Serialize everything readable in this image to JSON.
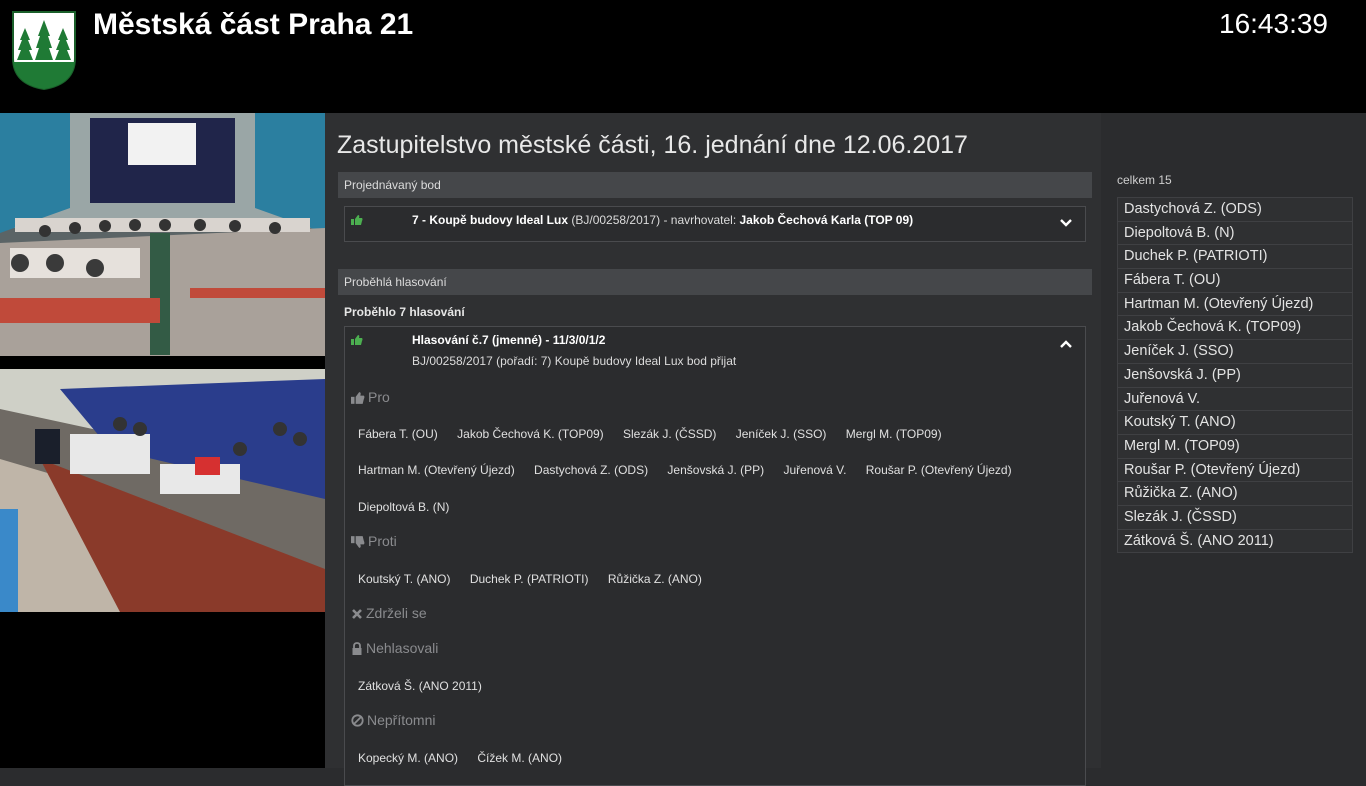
{
  "header": {
    "title": "Městská část Praha 21",
    "clock": "16:43:39"
  },
  "meeting": {
    "title": "Zastupitelstvo městské části, 16. jednání dne 12.06.2017"
  },
  "current_item": {
    "section_label": "Projednávaný bod",
    "number": "7 - Koupě budovy Ideal Lux",
    "code": "(BJ/00258/2017)",
    "proposer_label": "- navrhovatel:",
    "proposer": "Jakob Čechová Karla (TOP 09)"
  },
  "past_votes": {
    "section_label": "Proběhlá hlasování",
    "count_label": "Proběhlo 7 hlasování",
    "vote": {
      "title": "Hlasování č.7 (jmenné) - 11/3/0/1/2",
      "subtitle": "BJ/00258/2017 (pořadí: 7) Koupě budovy Ideal Lux bod přijat",
      "categories": {
        "for": {
          "label": "Pro",
          "rows": [
            [
              "Fábera T. (OU)",
              "Jakob Čechová K. (TOP09)",
              "Slezák J. (ČSSD)",
              "Jeníček J. (SSO)",
              "Mergl M. (TOP09)"
            ],
            [
              "Hartman M. (Otevřený Újezd)",
              "Dastychová Z. (ODS)",
              "Jenšovská J. (PP)",
              "Juřenová V.",
              "Roušar P. (Otevřený Újezd)"
            ],
            [
              "Diepoltová B. (N)"
            ]
          ]
        },
        "against": {
          "label": "Proti",
          "rows": [
            [
              "Koutský T. (ANO)",
              "Duchek P. (PATRIOTI)",
              "Růžička Z. (ANO)"
            ]
          ]
        },
        "abstained": {
          "label": "Zdrželi se"
        },
        "not_voted": {
          "label": "Nehlasovali",
          "rows": [
            [
              "Zátková Š. (ANO 2011)"
            ]
          ]
        },
        "absent": {
          "label": "Nepřítomni",
          "rows": [
            [
              "Kopecký M. (ANO)",
              "Čížek M. (ANO)"
            ]
          ]
        }
      }
    }
  },
  "members": {
    "total_label": "celkem 15",
    "items": [
      "Dastychová Z. (ODS)",
      "Diepoltová B. (N)",
      "Duchek P. (PATRIOTI)",
      "Fábera T. (OU)",
      "Hartman M. (Otevřený Újezd)",
      "Jakob Čechová K. (TOP09)",
      "Jeníček J. (SSO)",
      "Jenšovská J. (PP)",
      "Juřenová V.",
      "Koutský T. (ANO)",
      "Mergl M. (TOP09)",
      "Roušar P. (Otevřený Újezd)",
      "Růžička Z. (ANO)",
      "Slezák J. (ČSSD)",
      "Zátková Š. (ANO 2011)"
    ]
  },
  "icons": {
    "thumbs_up_color": "#4caf50",
    "logo": "praha-21-coat-of-arms"
  }
}
